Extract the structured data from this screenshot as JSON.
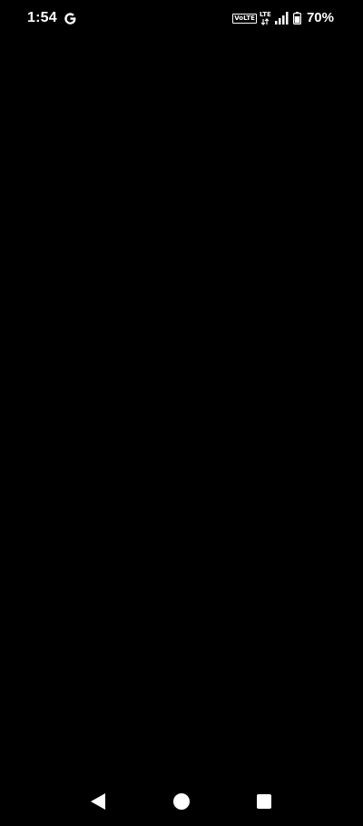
{
  "status_bar": {
    "time": "1:54",
    "volte_label": "VoLTE",
    "network_label": "LTE",
    "battery_percent": "70%",
    "icons": [
      "google-icon",
      "volte-icon",
      "lte-icon",
      "signal-icon",
      "battery-icon"
    ]
  },
  "nav_bar": {
    "buttons": [
      "back-button",
      "home-button",
      "recents-button"
    ]
  },
  "colors": {
    "background": "#000000",
    "foreground": "#ffffff"
  }
}
